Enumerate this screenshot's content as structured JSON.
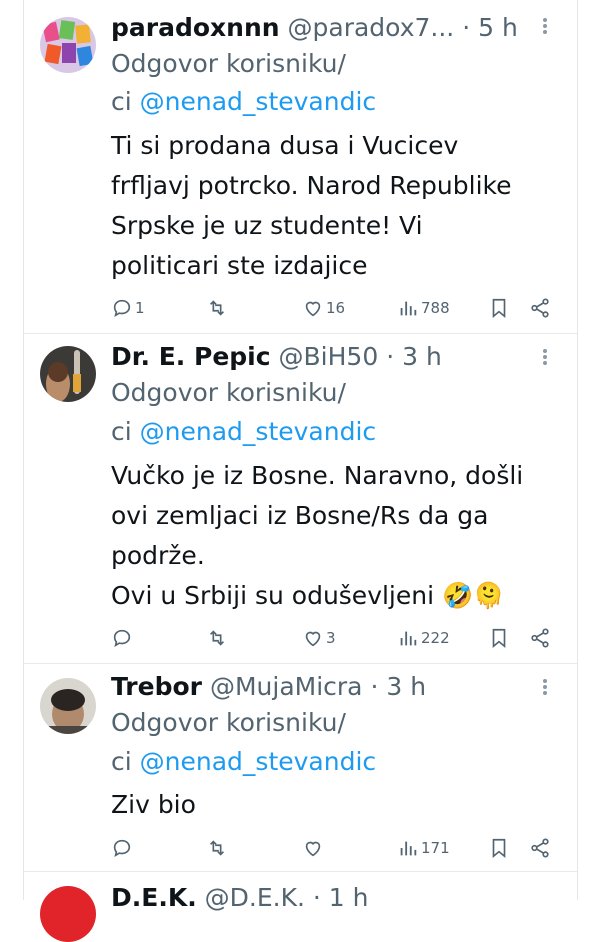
{
  "tweets": [
    {
      "name": "paradoxnnn",
      "handle": "@paradox7...",
      "dot": "·",
      "time": "5 h",
      "reply_prefix": "Odgovor korisniku/",
      "reply_line2_prefix": "ci",
      "mention": "@nenad_stevandic",
      "text_lines": [
        "Ti si prodana dusa i Vucicev",
        "frfljavj potrcko. Narod Republike",
        "Srpske je uz studente! Vi",
        "politicari ste izdajice"
      ],
      "replies": "1",
      "likes": "16",
      "views": "788"
    },
    {
      "name": "Dr. E. Pepic",
      "handle": "@BiH50",
      "dot": "·",
      "time": "3 h",
      "reply_prefix": "Odgovor korisniku/",
      "reply_line2_prefix": "ci",
      "mention": "@nenad_stevandic",
      "text_lines": [
        "Vučko je iz Bosne. Naravno, došli",
        "ovi zemljaci iz Bosne/Rs da ga",
        "podrže.",
        "Ovi u Srbiji su oduševljeni 🤣🫠"
      ],
      "replies": "",
      "likes": "3",
      "views": "222"
    },
    {
      "name": "Trebor",
      "handle": "@MujaMicra",
      "dot": "·",
      "time": "3 h",
      "reply_prefix": "Odgovor korisniku/",
      "reply_line2_prefix": "ci",
      "mention": "@nenad_stevandic",
      "text_lines": [
        "Ziv bio"
      ],
      "replies": "",
      "likes": "",
      "views": "171"
    }
  ],
  "partial": {
    "name": "D.E.K.",
    "handle": "@D.E.K.",
    "dot": "·",
    "time": "1 h"
  },
  "colors": {
    "accent": "#1d9bf0",
    "muted": "#536471",
    "text": "#0f1419"
  },
  "icons": [
    "reply-icon",
    "retweet-icon",
    "like-icon",
    "views-icon",
    "bookmark-icon",
    "share-icon",
    "more-icon"
  ]
}
